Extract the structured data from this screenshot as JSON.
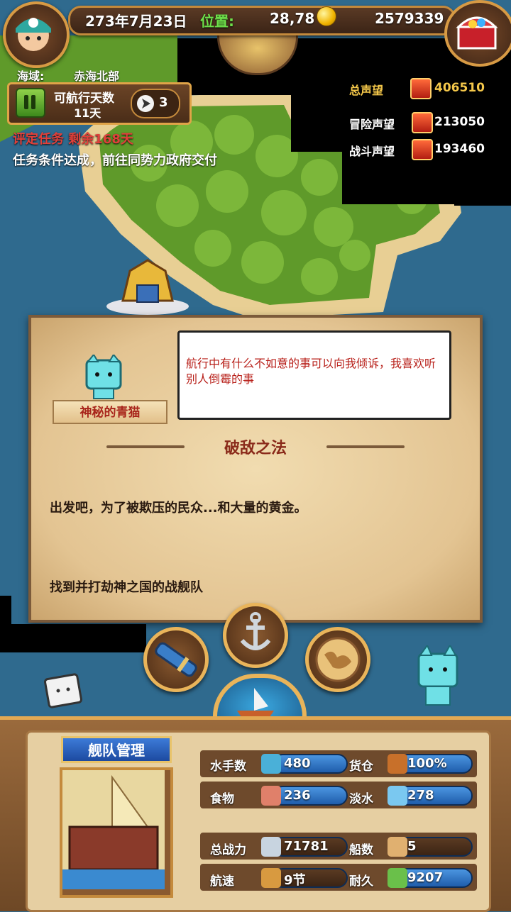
{
  "topbar": {
    "date": "273年7月23日",
    "position_label": "位置:",
    "position_value": "28,78",
    "gold": "2579339"
  },
  "sea_area": {
    "label": "海域:",
    "value": "赤海北部"
  },
  "sailing": {
    "label": "可航行天数",
    "days": "11天",
    "arrow_count": "3"
  },
  "mission": {
    "notice": "评定任务 剩余168天",
    "status": "任务条件达成，前往同势力政府交付"
  },
  "reputation": {
    "total_label": "总声望",
    "total_value": "406510",
    "adventure_label": "冒险声望",
    "adventure_value": "213050",
    "battle_label": "战斗声望",
    "battle_value": "193460"
  },
  "dialog": {
    "speaker": "神秘的青猫",
    "speech": "航行中有什么不如意的事可以向我倾诉，我喜欢听别人倒霉的事",
    "quest_title": "破敌之法",
    "quest_desc": "出发吧，为了被欺压的民众...和大量的黄金。",
    "quest_goal": "找到并打劫神之国的战舰队"
  },
  "fleet": {
    "tab_label": "舰队管理",
    "stats": {
      "sailors_label": "水手数",
      "sailors": "480",
      "cargo_label": "货仓",
      "cargo": "100%",
      "food_label": "食物",
      "food": "236",
      "water_label": "淡水",
      "water": "278",
      "power_label": "总战力",
      "power": "71781",
      "ships_label": "船数",
      "ships": "5",
      "speed_label": "航速",
      "speed": "9节",
      "durability_label": "耐久",
      "durability": "9207"
    }
  },
  "icons": {
    "avatar": "pirate-avatar-icon",
    "gold": "gold-coin-icon",
    "chest": "treasure-chest-icon",
    "telescope": "telescope-icon",
    "anchor": "anchor-icon",
    "map": "world-map-icon",
    "ship": "ship-icon"
  },
  "colors": {
    "accent_gold": "#e9b45a",
    "stat_blue": "#1f5dab",
    "mission_red": "#e0403a",
    "speech_red": "#b8201a"
  }
}
